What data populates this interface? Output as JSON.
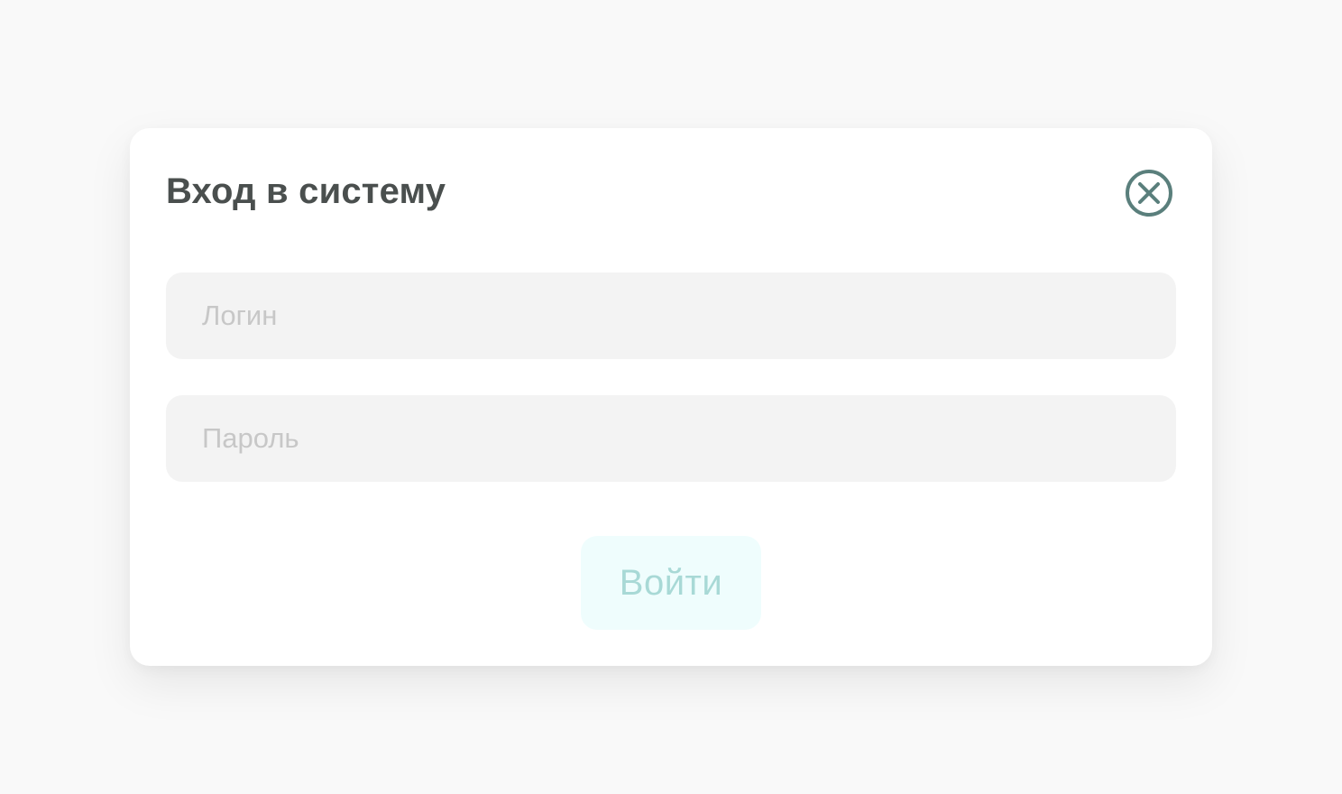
{
  "dialog": {
    "title": "Вход в систему",
    "close_icon": "close-circle-icon"
  },
  "form": {
    "login": {
      "placeholder": "Логин",
      "value": ""
    },
    "password": {
      "placeholder": "Пароль",
      "value": ""
    },
    "submit_label": "Войти"
  },
  "colors": {
    "page_background": "#f9f9f9",
    "dialog_background": "#ffffff",
    "title_text": "#4a4f4e",
    "close_icon": "#5a7f7c",
    "field_background": "#f3f3f3",
    "placeholder_text": "#c7c7c7",
    "submit_background": "#effdfd",
    "submit_text": "#a8d9d6"
  }
}
